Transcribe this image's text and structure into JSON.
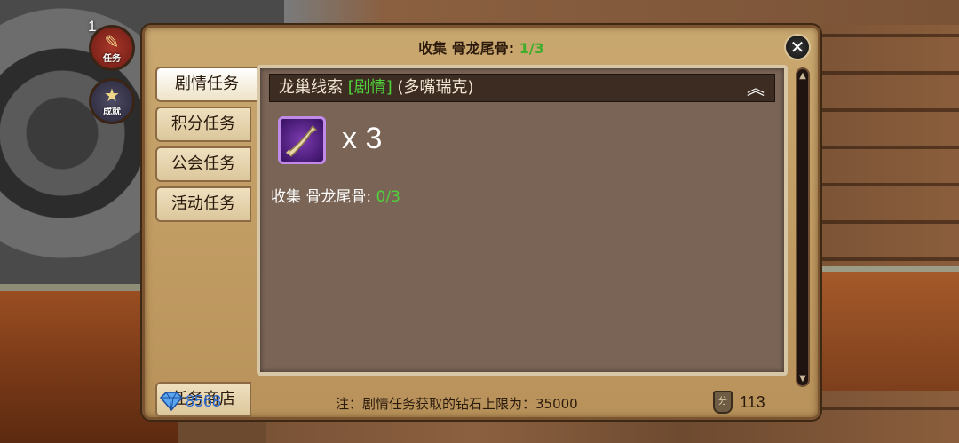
{
  "hud": {
    "quest_badge": "1",
    "quest_label": "任务",
    "achievement_label": "成就"
  },
  "panel": {
    "title_prefix": "收集 骨龙尾骨: ",
    "title_count": "1/3",
    "close_icon": "close-icon"
  },
  "tabs": [
    {
      "label": "剧情任务",
      "active": true
    },
    {
      "label": "积分任务",
      "active": false
    },
    {
      "label": "公会任务",
      "active": false
    },
    {
      "label": "活动任务",
      "active": false
    }
  ],
  "shop_tab": {
    "label": "任务商店"
  },
  "quest": {
    "title": "龙巢线索 ",
    "tag": "[剧情]",
    "npc": " (多嘴瑞克)",
    "item_icon": "bone-icon",
    "item_qty": "x 3",
    "objective_prefix": "收集 骨龙尾骨: ",
    "objective_count": "0/3"
  },
  "footer": {
    "diamonds": "8568",
    "note": "注：剧情任务获取的钻石上限为：35000",
    "points": "113",
    "points_glyph": "分"
  }
}
